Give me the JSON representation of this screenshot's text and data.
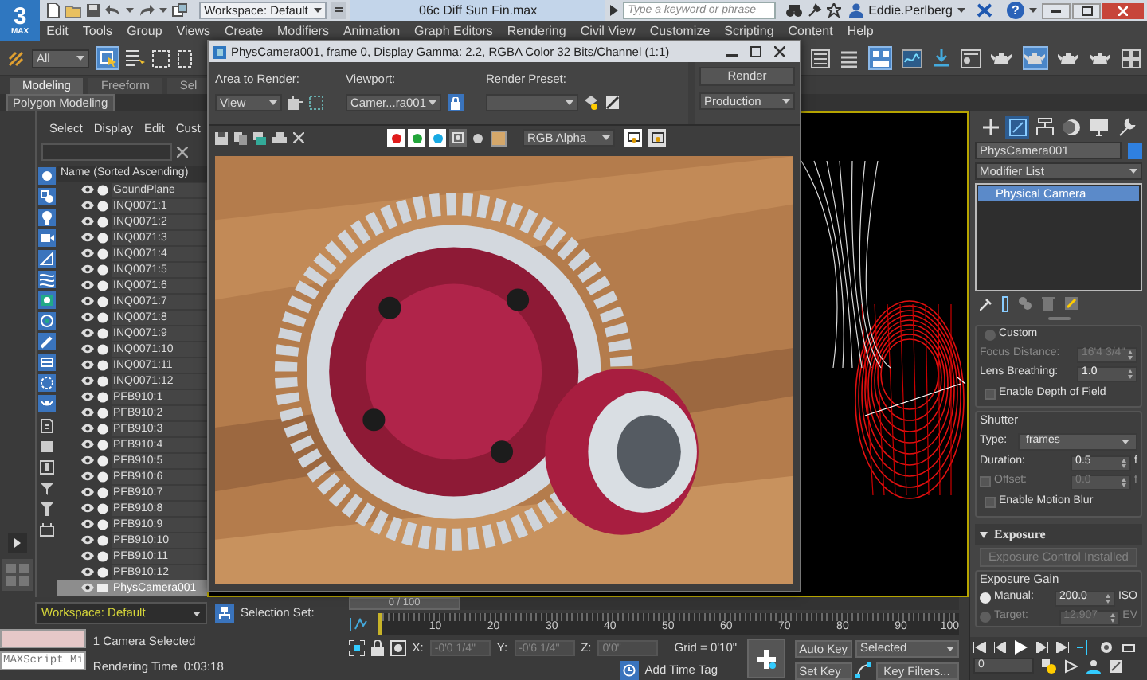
{
  "app_logo": {
    "number": "3",
    "label": "MAX"
  },
  "title_bar": {
    "workspace": "Workspace: Default",
    "title": "06c Diff Sun Fin.max",
    "search": {
      "placeholder": "Type a keyword or phrase"
    },
    "user": "Eddie.Perlberg",
    "help": "?"
  },
  "menu": [
    "Edit",
    "Tools",
    "Group",
    "Views",
    "Create",
    "Modifiers",
    "Animation",
    "Graph Editors",
    "Rendering",
    "Civil View",
    "Customize",
    "Scripting",
    "Content",
    "Help"
  ],
  "toolbar": {
    "selection_filter": "All"
  },
  "ribbon": {
    "tabs": [
      {
        "label": "Modeling",
        "selected": true
      },
      {
        "label": "Freeform",
        "selected": false
      },
      {
        "label": "Sel",
        "selected": false
      }
    ],
    "panel": "Polygon Modeling"
  },
  "scene_explorer": {
    "menu": [
      "Select",
      "Display",
      "Edit",
      "Cust"
    ],
    "column": "Name (Sorted Ascending)",
    "rows": [
      {
        "name": "GoundPlane",
        "kind": "object",
        "selected": false
      },
      {
        "name": "INQ0071:1",
        "kind": "object",
        "selected": false
      },
      {
        "name": "INQ0071:2",
        "kind": "object",
        "selected": false
      },
      {
        "name": "INQ0071:3",
        "kind": "object",
        "selected": false
      },
      {
        "name": "INQ0071:4",
        "kind": "object",
        "selected": false
      },
      {
        "name": "INQ0071:5",
        "kind": "object",
        "selected": false
      },
      {
        "name": "INQ0071:6",
        "kind": "object",
        "selected": false
      },
      {
        "name": "INQ0071:7",
        "kind": "object",
        "selected": false
      },
      {
        "name": "INQ0071:8",
        "kind": "object",
        "selected": false
      },
      {
        "name": "INQ0071:9",
        "kind": "object",
        "selected": false
      },
      {
        "name": "INQ0071:10",
        "kind": "object",
        "selected": false
      },
      {
        "name": "INQ0071:11",
        "kind": "object",
        "selected": false
      },
      {
        "name": "INQ0071:12",
        "kind": "object",
        "selected": false
      },
      {
        "name": "PFB910:1",
        "kind": "object",
        "selected": false
      },
      {
        "name": "PFB910:2",
        "kind": "object",
        "selected": false
      },
      {
        "name": "PFB910:3",
        "kind": "object",
        "selected": false
      },
      {
        "name": "PFB910:4",
        "kind": "object",
        "selected": false
      },
      {
        "name": "PFB910:5",
        "kind": "object",
        "selected": false
      },
      {
        "name": "PFB910:6",
        "kind": "object",
        "selected": false
      },
      {
        "name": "PFB910:7",
        "kind": "object",
        "selected": false
      },
      {
        "name": "PFB910:8",
        "kind": "object",
        "selected": false
      },
      {
        "name": "PFB910:9",
        "kind": "object",
        "selected": false
      },
      {
        "name": "PFB910:10",
        "kind": "object",
        "selected": false
      },
      {
        "name": "PFB910:11",
        "kind": "object",
        "selected": false
      },
      {
        "name": "PFB910:12",
        "kind": "object",
        "selected": false
      },
      {
        "name": "PhysCamera001",
        "kind": "camera",
        "selected": true
      }
    ]
  },
  "render_window": {
    "title": "PhysCamera001, frame 0, Display Gamma: 2.2, RGBA Color 32 Bits/Channel (1:1)",
    "area_label": "Area to Render:",
    "area": "View",
    "viewport_label": "Viewport:",
    "viewport": "Camer...ra001",
    "preset_label": "Render Preset:",
    "render_button": "Render",
    "mode": "Production",
    "channels": [
      {
        "color": "#e01b1b",
        "on": true
      },
      {
        "color": "#22a53a",
        "on": true
      },
      {
        "color": "#17a9e3",
        "on": true
      }
    ],
    "display": "RGB Alpha"
  },
  "bottom": {
    "workspace": "Workspace: Default",
    "maxscript": "MAXScript Mi",
    "status": "1 Camera Selected",
    "render_time_label": "Rendering Time",
    "render_time": "0:03:18",
    "selection_set": "Selection Set:"
  },
  "timeline": {
    "slider": "0 / 100",
    "ticks": [
      "10",
      "20",
      "30",
      "40",
      "50",
      "60",
      "70",
      "80",
      "90",
      "100"
    ]
  },
  "coordinates": [
    {
      "label": "X:",
      "value": "-0'0 1/4\""
    },
    {
      "label": "Y:",
      "value": "-0'6 1/4\""
    },
    {
      "label": "Z:",
      "value": "0'0\""
    }
  ],
  "grid": "Grid = 0'10\"",
  "time_tag": "Add Time Tag",
  "auto_key": "Auto Key",
  "key_mode": "Selected",
  "set_key": "Set Key",
  "key_filters": "Key Filters...",
  "command_panel": {
    "tabs": [
      {
        "kind": "create",
        "selected": false
      },
      {
        "kind": "modify",
        "selected": true
      },
      {
        "kind": "hierarchy",
        "selected": false
      },
      {
        "kind": "motion",
        "selected": false
      },
      {
        "kind": "display",
        "selected": false
      },
      {
        "kind": "utilities",
        "selected": false
      }
    ],
    "object_name": "PhysCamera001",
    "modifier_list": "Modifier List",
    "stack": [
      {
        "name": "Physical Camera",
        "selected": true
      }
    ],
    "lens": [
      {
        "kind": "radio",
        "label": "Custom",
        "selected": false
      },
      {
        "kind": "spinner",
        "label": "Focus Distance:",
        "value": "16'4 3/4\"",
        "disabled": true
      },
      {
        "kind": "spinner",
        "label": "Lens Breathing:",
        "value": "1.0",
        "disabled": false
      },
      {
        "kind": "checkbox",
        "label": "Enable Depth of Field",
        "checked": false
      }
    ],
    "shutter": {
      "title": "Shutter",
      "items": [
        {
          "kind": "dropdown",
          "label": "Type:",
          "value": "frames"
        },
        {
          "kind": "spinner",
          "label": "Duration:",
          "value": "0.5",
          "unit": "f",
          "disabled": false
        },
        {
          "kind": "check_spinner",
          "label": "Offset:",
          "value": "0.0",
          "unit": "f",
          "checked": false,
          "disabled": true
        },
        {
          "kind": "checkbox",
          "label": "Enable Motion Blur",
          "checked": false
        }
      ]
    },
    "exposure": {
      "title": "Exposure",
      "button": "Exposure Control Installed",
      "group": "Exposure Gain",
      "items": [
        {
          "kind": "radio_spinner",
          "label": "Manual:",
          "value": "200.0",
          "unit": "ISO",
          "selected": true,
          "disabled": false
        },
        {
          "kind": "radio_spinner",
          "label": "Target:",
          "value": "12.907",
          "unit": "EV",
          "selected": false,
          "disabled": true
        }
      ]
    }
  },
  "animation_controls": {
    "frame": "0"
  }
}
